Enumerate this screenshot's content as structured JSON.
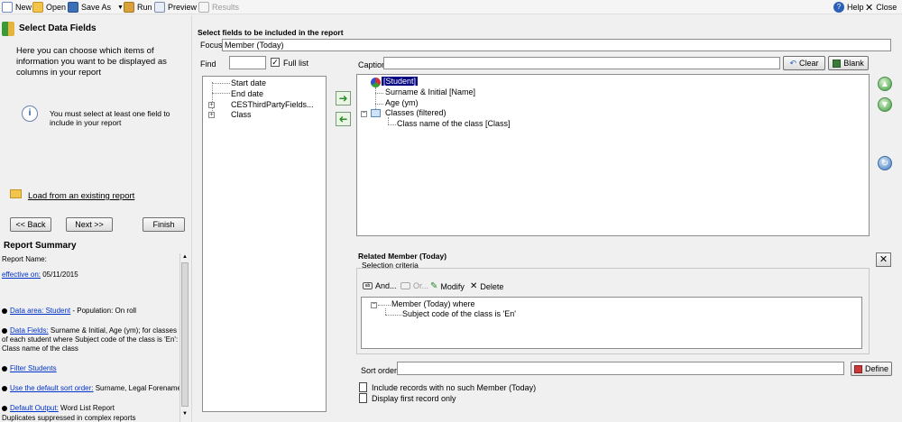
{
  "toolbar": {
    "new": "New",
    "open": "Open",
    "save_as": "Save As",
    "run": "Run",
    "preview": "Preview",
    "results": "Results",
    "help": "Help",
    "close": "Close"
  },
  "left": {
    "title": "Select Data Fields",
    "intro": "Here you can choose which items of information you want to be displayed as columns in your report",
    "info": "You must select at least one field to include in your report",
    "load_link": "Load from an existing report",
    "back": "<< Back",
    "next": "Next >>",
    "finish": "Finish",
    "summary_title": "Report Summary",
    "report_name_label": "Report Name:",
    "effective_link": "effective on:",
    "effective_value": " 05/11/2015",
    "data_area_link": "Data area: Student",
    "data_area_text": " - Population: On roll",
    "data_fields_link": "Data Fields:",
    "data_fields_text": " Surname & Initial, Age (ym); for classes of each student where Subject code of the class is 'En': Class name of the class",
    "filter_link": "Filter Students",
    "sort_link": "Use the default sort order:",
    "sort_text": " Surname, Legal Forename",
    "output_link": "Default Output:",
    "output_text": " Word List Report",
    "output_note": "Duplicates suppressed in complex reports"
  },
  "main": {
    "section_title": "Select fields to be included in the report",
    "focus_label": "Focus",
    "focus_value": "Member (Today)",
    "find_label": "Find",
    "find_value": "",
    "full_list_label": "Full list",
    "caption_label": "Caption",
    "caption_value": "",
    "clear": "Clear",
    "blank": "Blank",
    "available_fields": [
      {
        "label": "Start date",
        "expandable": false
      },
      {
        "label": "End date",
        "expandable": false
      },
      {
        "label": "CESThirdPartyFields...",
        "expandable": true
      },
      {
        "label": "Class",
        "expandable": true
      }
    ],
    "selected_tree": {
      "root": "[Student]",
      "children": [
        "Surname & Initial [Name]",
        "Age (ym)"
      ],
      "group": "Classes (filtered)",
      "group_child": "Class name of the class [Class]"
    },
    "related_title": "Related Member (Today)",
    "selection_criteria": "Selection criteria",
    "and": "And...",
    "or": "Or...",
    "modify": "Modify",
    "delete": "Delete",
    "criteria_root": "Member (Today) where",
    "criteria_child": "Subject code of the class is 'En'",
    "sort_order_label": "Sort order",
    "sort_order_value": "",
    "define": "Define",
    "include_records": "Include records with no such Member (Today)",
    "display_first": "Display first record only"
  },
  "colors": {
    "link": "#0033cc",
    "panel_bg": "#ffffff",
    "window_bg": "#f0f0f0",
    "selected_bg": "#000080"
  }
}
